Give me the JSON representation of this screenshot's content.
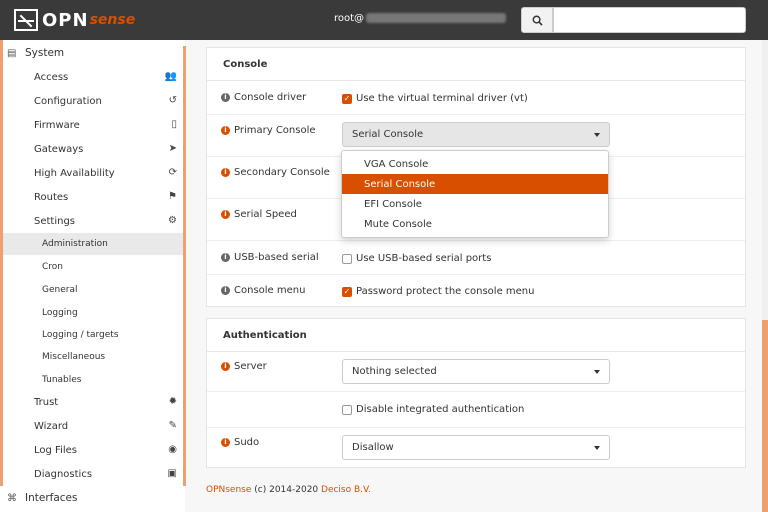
{
  "header": {
    "brand_main": "OPN",
    "brand_accent": "sense",
    "user_label": "root@",
    "search_placeholder": ""
  },
  "sidebar": {
    "system_label": "System",
    "items": [
      {
        "label": "Access",
        "icon": "users-icon",
        "glyph": "👥"
      },
      {
        "label": "Configuration",
        "icon": "history-icon",
        "glyph": "↺"
      },
      {
        "label": "Firmware",
        "icon": "tablet-icon",
        "glyph": "▯"
      },
      {
        "label": "Gateways",
        "icon": "location-arrow-icon",
        "glyph": "➤"
      },
      {
        "label": "High Availability",
        "icon": "refresh-icon",
        "glyph": "⟳"
      },
      {
        "label": "Routes",
        "icon": "map-signs-icon",
        "glyph": "⚑"
      },
      {
        "label": "Settings",
        "icon": "cogs-icon",
        "glyph": "⚙"
      }
    ],
    "settings_sub": [
      "Administration",
      "Cron",
      "General",
      "Logging",
      "Logging / targets",
      "Miscellaneous",
      "Tunables"
    ],
    "items_after": [
      {
        "label": "Trust",
        "icon": "certificate-icon",
        "glyph": "✹"
      },
      {
        "label": "Wizard",
        "icon": "magic-icon",
        "glyph": "✎"
      },
      {
        "label": "Log Files",
        "icon": "eye-icon",
        "glyph": "◉"
      },
      {
        "label": "Diagnostics",
        "icon": "medkit-icon",
        "glyph": "▣"
      }
    ],
    "interfaces_label": "Interfaces"
  },
  "console": {
    "title": "Console",
    "driver_label": "Console driver",
    "driver_check": "Use the virtual terminal driver (vt)",
    "primary_label": "Primary Console",
    "primary_value": "Serial Console",
    "secondary_label": "Secondary Console",
    "serial_speed_label": "Serial Speed",
    "usb_label": "USB-based serial",
    "usb_check": "Use USB-based serial ports",
    "menu_label": "Console menu",
    "menu_check": "Password protect the console menu",
    "dropdown_options": [
      "VGA Console",
      "Serial Console",
      "EFI Console",
      "Mute Console"
    ]
  },
  "auth": {
    "title": "Authentication",
    "server_label": "Server",
    "server_value": "Nothing selected",
    "disable_check": "Disable integrated authentication",
    "sudo_label": "Sudo",
    "sudo_value": "Disallow"
  },
  "footer": {
    "brand": "OPNsense",
    "copyright": " (c) 2014-2020 ",
    "company": "Deciso B.V."
  },
  "colors": {
    "accent": "#d94f00",
    "topbar": "#3a3a3a"
  }
}
